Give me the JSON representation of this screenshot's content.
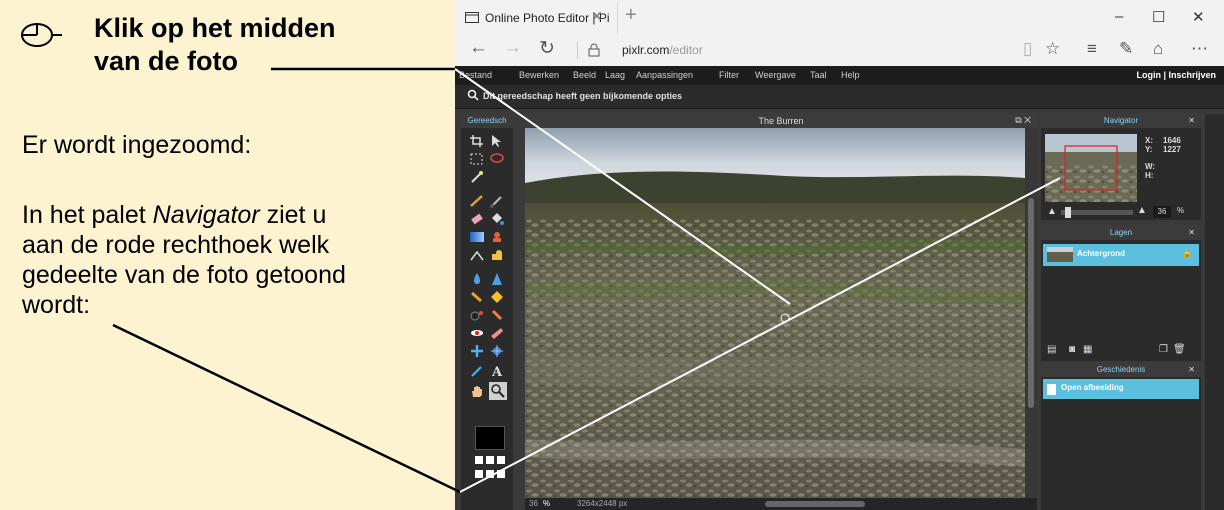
{
  "instructions": {
    "step_line1": "Klik op het midden",
    "step_line2": "van de foto",
    "para1": "Er wordt ingezoomd:",
    "para2_prefix": "In het palet ",
    "para2_italic": "Navigator",
    "para2_suffix": " ziet u",
    "para2_line2": "aan de rode rechthoek welk",
    "para2_line3": "gedeelte van de foto getoond",
    "para2_line4": "wordt:"
  },
  "browser": {
    "tab_title": "Online Photo Editor | Pi",
    "url_domain": "pixlr.com",
    "url_path": "/editor"
  },
  "app": {
    "menu": [
      "Bestand",
      "Bewerken",
      "Beeld",
      "Laag",
      "Aanpassingen",
      "Filter",
      "Weergave",
      "Taal",
      "Help"
    ],
    "login": "Login  |  Inschrijven",
    "options_text": "Dit gereedschap heeft geen bijkomende opties",
    "toolbox_title": "Gereedsch",
    "document_title": "The Burren",
    "zoom_status": "36",
    "zoom_unit": "%",
    "image_size": "3264x2448 px",
    "navigator": {
      "title": "Navigator",
      "x_label": "X:",
      "x_value": "1646",
      "y_label": "Y:",
      "y_value": "1227",
      "w_label": "W:",
      "h_label": "H:",
      "zoom": "36",
      "zoom_unit": "%"
    },
    "layers": {
      "title": "Lagen",
      "items": [
        "Achtergrond"
      ]
    },
    "history": {
      "title": "Geschiedenis",
      "items": [
        "Open afbeelding"
      ]
    }
  },
  "colors": {
    "instruction_bg": "#fdf3d1",
    "accent_blue": "#5bc0de",
    "panel_dark": "#2b2b2b",
    "nav_rect": "#e02020"
  }
}
